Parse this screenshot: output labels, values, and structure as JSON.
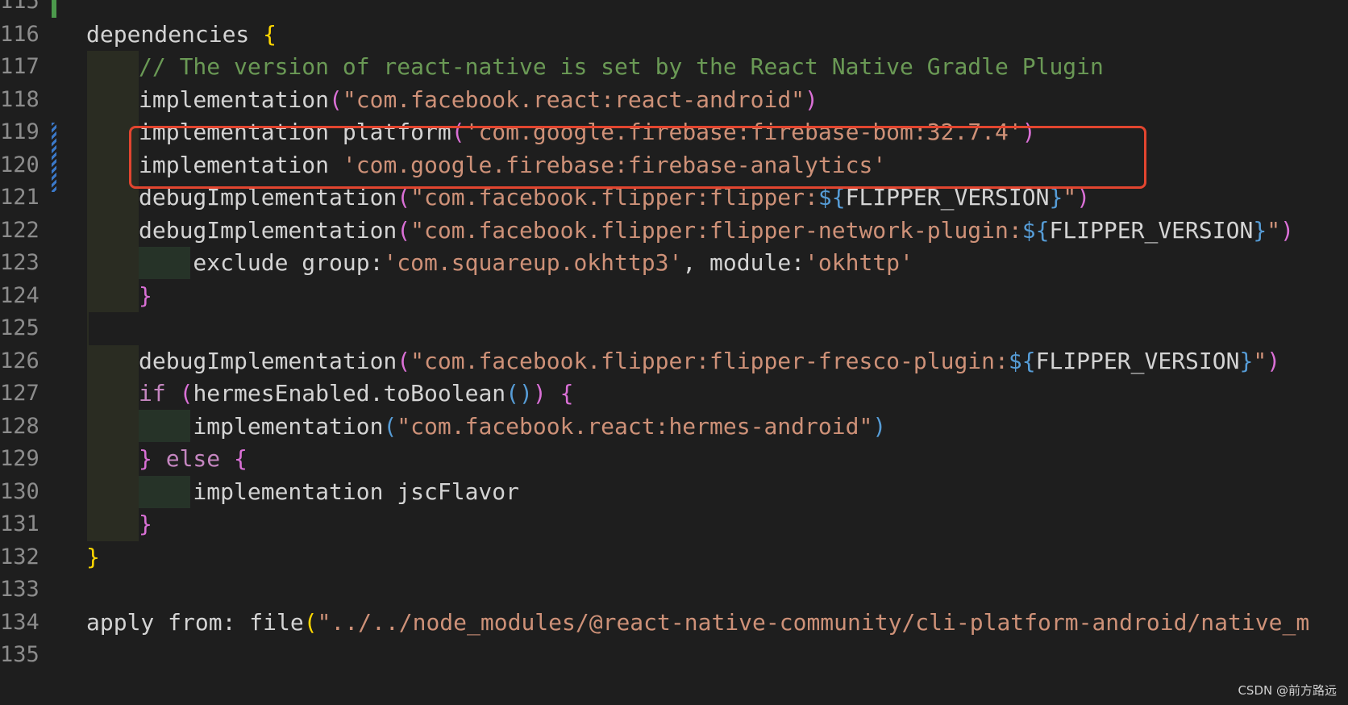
{
  "editor": {
    "lines": [
      {
        "num": "115",
        "tokens": []
      },
      {
        "num": "116",
        "tokens": [
          {
            "t": "dependencies ",
            "c": "plain"
          },
          {
            "t": "{",
            "c": "brace"
          }
        ]
      },
      {
        "num": "117",
        "tokens": [
          {
            "t": "// The version of react-native is set by the React Native Gradle Plugin",
            "c": "comment"
          }
        ]
      },
      {
        "num": "118",
        "tokens": [
          {
            "t": "implementation",
            "c": "plain"
          },
          {
            "t": "(",
            "c": "paren"
          },
          {
            "t": "\"com.facebook.react:react-android\"",
            "c": "string"
          },
          {
            "t": ")",
            "c": "paren"
          }
        ]
      },
      {
        "num": "119",
        "tokens": [
          {
            "t": "implementation platform",
            "c": "plain"
          },
          {
            "t": "(",
            "c": "paren"
          },
          {
            "t": "'com.google.firebase:firebase-bom:32.7.4'",
            "c": "string"
          },
          {
            "t": ")",
            "c": "paren"
          }
        ]
      },
      {
        "num": "120",
        "tokens": [
          {
            "t": "implementation ",
            "c": "plain"
          },
          {
            "t": "'com.google.firebase:firebase-analytics'",
            "c": "string"
          }
        ]
      },
      {
        "num": "121",
        "tokens": [
          {
            "t": "debugImplementation",
            "c": "plain"
          },
          {
            "t": "(",
            "c": "paren"
          },
          {
            "t": "\"com.facebook.flipper:flipper:",
            "c": "string"
          },
          {
            "t": "${",
            "c": "interp"
          },
          {
            "t": "FLIPPER_VERSION",
            "c": "plain"
          },
          {
            "t": "}",
            "c": "interp"
          },
          {
            "t": "\"",
            "c": "string"
          },
          {
            "t": ")",
            "c": "paren"
          }
        ]
      },
      {
        "num": "122",
        "tokens": [
          {
            "t": "debugImplementation",
            "c": "plain"
          },
          {
            "t": "(",
            "c": "paren"
          },
          {
            "t": "\"com.facebook.flipper:flipper-network-plugin:",
            "c": "string"
          },
          {
            "t": "${",
            "c": "interp"
          },
          {
            "t": "FLIPPER_VERSION",
            "c": "plain"
          },
          {
            "t": "}",
            "c": "interp"
          },
          {
            "t": "\"",
            "c": "string"
          },
          {
            "t": ")",
            "c": "paren"
          }
        ]
      },
      {
        "num": "123",
        "tokens": [
          {
            "t": "    exclude group:",
            "c": "plain"
          },
          {
            "t": "'com.squareup.okhttp3'",
            "c": "string"
          },
          {
            "t": ", module:",
            "c": "plain"
          },
          {
            "t": "'okhttp'",
            "c": "string"
          }
        ]
      },
      {
        "num": "124",
        "tokens": [
          {
            "t": "}",
            "c": "paren"
          }
        ]
      },
      {
        "num": "125",
        "tokens": []
      },
      {
        "num": "126",
        "tokens": [
          {
            "t": "debugImplementation",
            "c": "plain"
          },
          {
            "t": "(",
            "c": "paren"
          },
          {
            "t": "\"com.facebook.flipper:flipper-fresco-plugin:",
            "c": "string"
          },
          {
            "t": "${",
            "c": "interp"
          },
          {
            "t": "FLIPPER_VERSION",
            "c": "plain"
          },
          {
            "t": "}",
            "c": "interp"
          },
          {
            "t": "\"",
            "c": "string"
          },
          {
            "t": ")",
            "c": "paren"
          }
        ]
      },
      {
        "num": "127",
        "tokens": [
          {
            "t": "if ",
            "c": "keyword"
          },
          {
            "t": "(",
            "c": "paren"
          },
          {
            "t": "hermesEnabled.toBoolean",
            "c": "plain"
          },
          {
            "t": "()",
            "c": "bluep"
          },
          {
            "t": ")",
            "c": "paren"
          },
          {
            "t": " ",
            "c": "plain"
          },
          {
            "t": "{",
            "c": "paren"
          }
        ]
      },
      {
        "num": "128",
        "tokens": [
          {
            "t": "    implementation",
            "c": "plain"
          },
          {
            "t": "(",
            "c": "bluep"
          },
          {
            "t": "\"com.facebook.react:hermes-android\"",
            "c": "string"
          },
          {
            "t": ")",
            "c": "bluep"
          }
        ]
      },
      {
        "num": "129",
        "tokens": [
          {
            "t": "} ",
            "c": "paren"
          },
          {
            "t": "else ",
            "c": "keyword"
          },
          {
            "t": "{",
            "c": "paren"
          }
        ]
      },
      {
        "num": "130",
        "tokens": [
          {
            "t": "    implementation jscFlavor",
            "c": "plain"
          }
        ]
      },
      {
        "num": "131",
        "tokens": [
          {
            "t": "}",
            "c": "paren"
          }
        ]
      },
      {
        "num": "132",
        "tokens": [
          {
            "t": "}",
            "c": "brace"
          }
        ]
      },
      {
        "num": "133",
        "tokens": []
      },
      {
        "num": "134",
        "tokens": [
          {
            "t": "apply from: file",
            "c": "plain"
          },
          {
            "t": "(",
            "c": "brace"
          },
          {
            "t": "\"../../node_modules/@react-native-community/cli-platform-android/native_m",
            "c": "string"
          }
        ]
      },
      {
        "num": "135",
        "tokens": []
      }
    ]
  },
  "watermark": "CSDN @前方路远",
  "colors": {
    "background": "#1e1e1e",
    "highlight_box": "#e2452f",
    "comment": "#6a9955",
    "string": "#ce9178"
  }
}
